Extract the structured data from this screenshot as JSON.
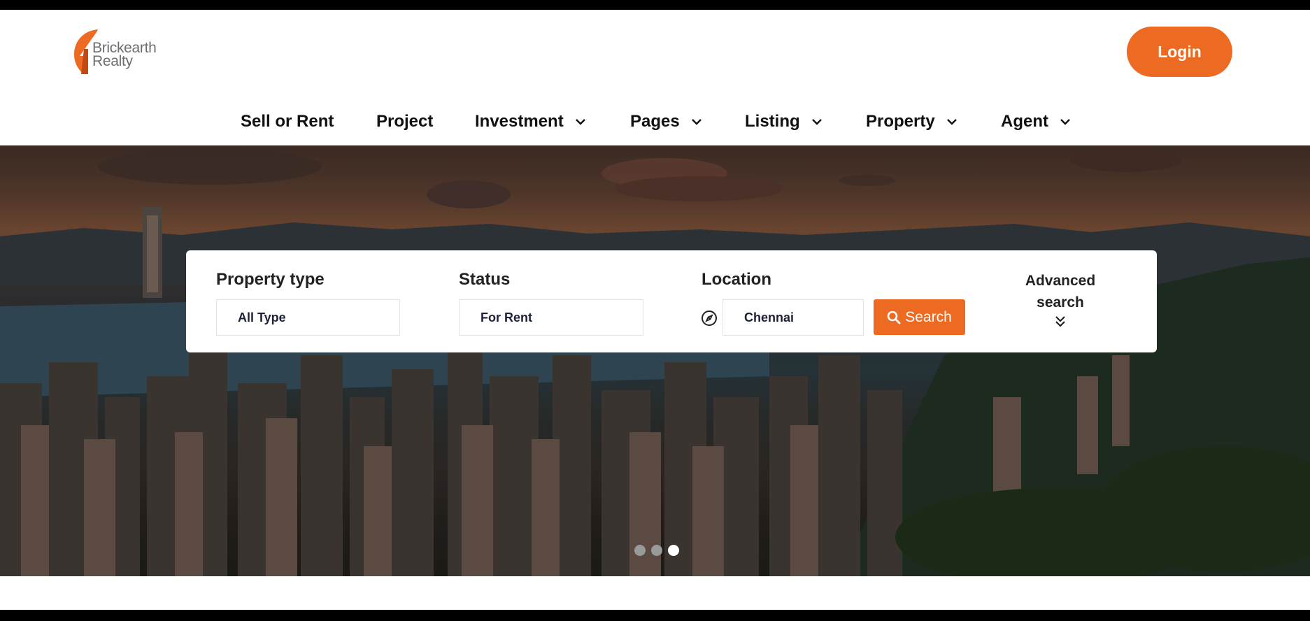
{
  "brand": {
    "name_line1": "Brickearth",
    "name_line2": "Realty",
    "accent_color": "#ec6a21"
  },
  "header": {
    "login_label": "Login"
  },
  "nav": {
    "items": [
      {
        "label": "Sell or Rent",
        "dropdown": false
      },
      {
        "label": "Project",
        "dropdown": false
      },
      {
        "label": "Investment",
        "dropdown": true
      },
      {
        "label": "Pages",
        "dropdown": true
      },
      {
        "label": "Listing",
        "dropdown": true
      },
      {
        "label": "Property",
        "dropdown": true
      },
      {
        "label": "Agent",
        "dropdown": true
      }
    ]
  },
  "search": {
    "property_type": {
      "label": "Property type",
      "value": "All Type"
    },
    "status": {
      "label": "Status",
      "value": "For Rent"
    },
    "location": {
      "label": "Location",
      "value": "Chennai",
      "icon": "compass-icon"
    },
    "button_label": "Search",
    "advanced_line1": "Advanced",
    "advanced_line2": "search"
  },
  "carousel": {
    "slide_count": 3,
    "active_index": 2
  }
}
